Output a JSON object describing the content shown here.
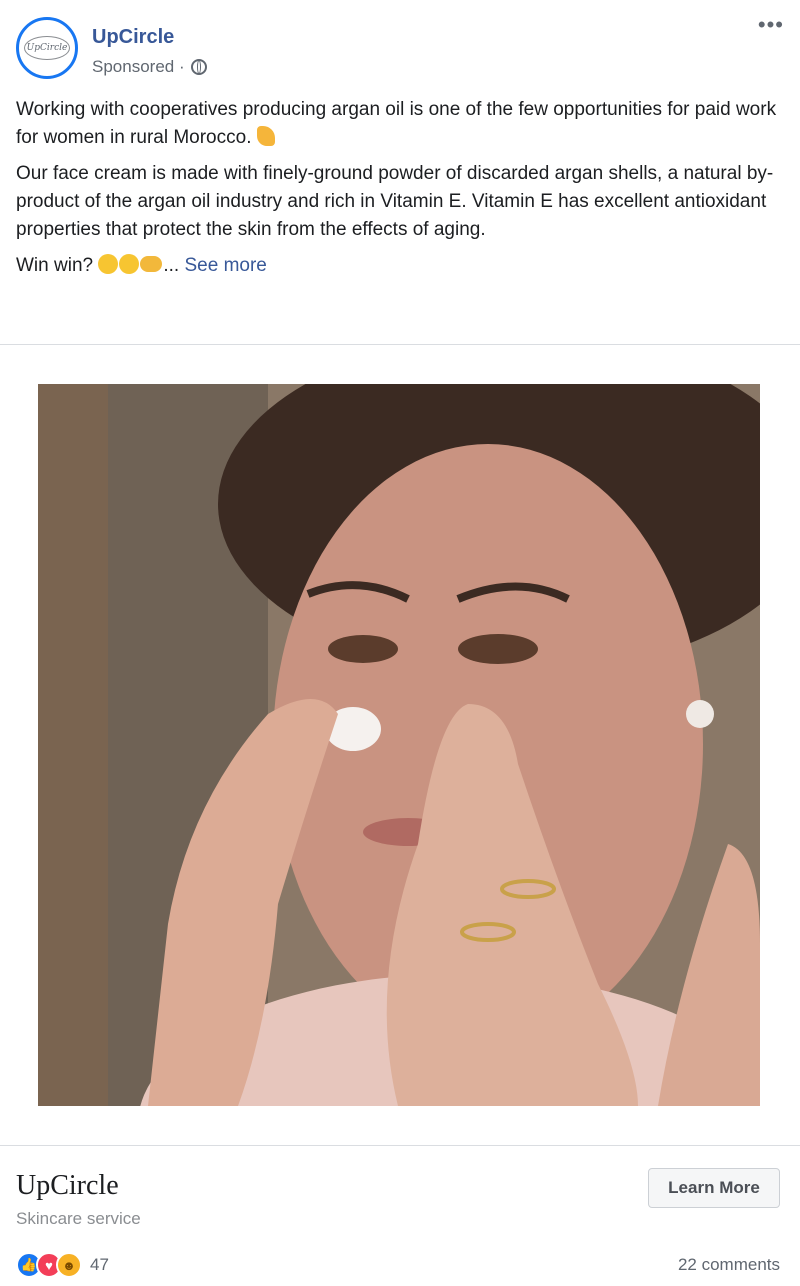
{
  "post": {
    "page_name": "UpCircle",
    "sponsored_label": "Sponsored ·",
    "avatar_text": "UpCircle",
    "paragraph1": "Working with cooperatives producing argan oil is one of the few opportunities for paid work for women in rural Morocco.",
    "paragraph2": "Our face cream is made with finely-ground powder of discarded argan shells, a natural by-product of the argan oil industry and rich in Vitamin E. Vitamin E has excellent antioxidant properties that protect the skin from the effects of aging.",
    "paragraph3_prefix": "Win win?",
    "ellipsis": "...",
    "see_more": "See more"
  },
  "link": {
    "headline": "UpCircle",
    "description": "Skincare service",
    "cta_label": "Learn More"
  },
  "engagement": {
    "reaction_count": "47",
    "comments": "22 comments",
    "reaction_icons": [
      "like-icon",
      "love-icon",
      "haha-icon"
    ]
  },
  "colors": {
    "link_blue": "#385898",
    "fb_blue": "#1877f2",
    "muted": "#606770"
  }
}
